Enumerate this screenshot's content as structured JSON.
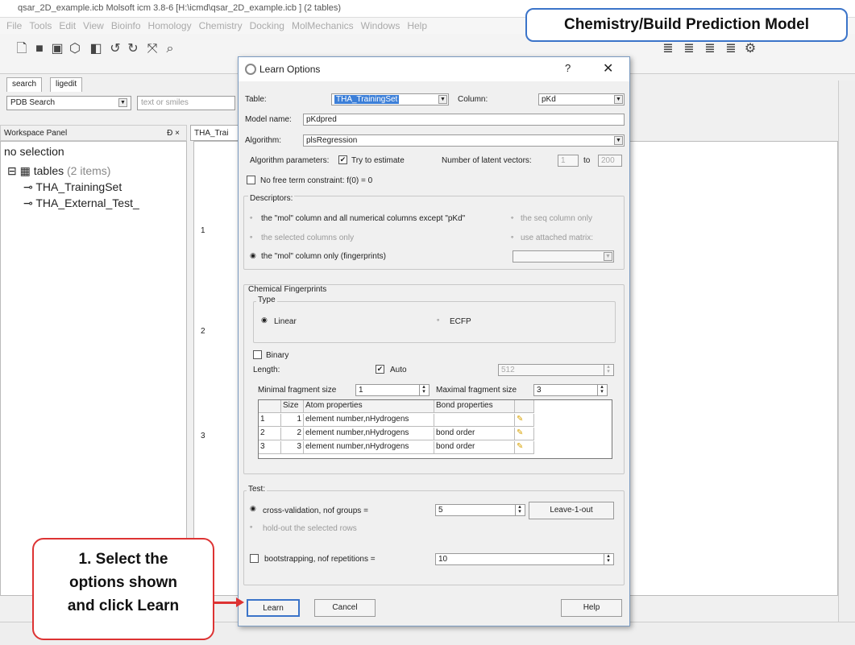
{
  "app": {
    "title": "qsar_2D_example.icb Molsoft icm 3.8-6  [H:\\icmd\\qsar_2D_example.icb ] (2 tables)",
    "menu": [
      "File",
      "Tools",
      "Edit",
      "View",
      "Bioinfo",
      "Homology",
      "Chemistry",
      "Docking",
      "MolMechanics",
      "Windows",
      "Help"
    ]
  },
  "search_tabs": [
    "search",
    "ligedit"
  ],
  "search": {
    "source": "PDB Search",
    "placeholder": "text or smiles"
  },
  "workspace": {
    "header": "Workspace Panel",
    "header_controls": "Ɖ ×",
    "selection": "no selection",
    "tables_label": "tables",
    "tables_count": "(2 items)",
    "items": [
      "THA_TrainingSet",
      "THA_External_Test_"
    ]
  },
  "doc_tab": "THA_Trai",
  "table_rows": [
    "1",
    "2",
    "3"
  ],
  "callout_top": "Chemistry/Build Prediction Model",
  "callout_bottom": [
    "1. Select the",
    "options shown",
    "and click Learn"
  ],
  "dialog": {
    "title": "Learn Options",
    "help_glyph": "?",
    "close_glyph": "✕",
    "table_label": "Table:",
    "table_value": "THA_TrainingSet",
    "column_label": "Column:",
    "column_value": "pKd",
    "model_name_label": "Model name:",
    "model_name_value": "pKdpred",
    "algorithm_label": "Algorithm:",
    "algorithm_value": "plsRegression",
    "alg_params_label": "Algorithm parameters:",
    "try_estimate": "Try to estimate",
    "latent_label": "Number of latent vectors:",
    "latent_from": "1",
    "latent_to_label": "to",
    "latent_to": "200",
    "no_free_term": "No free term constraint: f(0) = 0",
    "descriptors_title": "Descriptors:",
    "desc_opt1": "the \"mol\" column and all numerical columns except \"pKd\"",
    "desc_opt2": "the seq column only",
    "desc_opt3": "the selected columns only",
    "desc_opt4": "use attached matrix:",
    "desc_opt5": "the \"mol\" column only (fingerprints)",
    "chem_fp_title": "Chemical Fingerprints",
    "type_title": "Type",
    "type_linear": "Linear",
    "type_ecfp": "ECFP",
    "binary": "Binary",
    "length_label": "Length:",
    "auto": "Auto",
    "length_value": "512",
    "min_frag_label": "Minimal fragment size",
    "min_frag_value": "1",
    "max_frag_label": "Maximal fragment size",
    "max_frag_value": "3",
    "fp_headers": [
      "",
      "Size",
      "Atom properties",
      "Bond properties",
      ""
    ],
    "fp_rows": [
      {
        "n": "1",
        "size": "1",
        "atom": "element number,nHydrogens",
        "bond": ""
      },
      {
        "n": "2",
        "size": "2",
        "atom": "element number,nHydrogens",
        "bond": "bond order"
      },
      {
        "n": "3",
        "size": "3",
        "atom": "element number,nHydrogens",
        "bond": "bond order"
      }
    ],
    "test_title": "Test:",
    "cv_label": "cross-validation, nof groups =",
    "cv_value": "5",
    "leave1out": "Leave-1-out",
    "holdout_label": "hold-out the selected rows",
    "boot_label": "bootstrapping, nof repetitions =",
    "boot_value": "10",
    "learn_btn": "Learn",
    "cancel_btn": "Cancel",
    "help_btn": "Help"
  },
  "colors": {
    "callout_blue": "#3b74c9",
    "callout_red": "#dd3333",
    "selection": "#3c7fd8"
  }
}
